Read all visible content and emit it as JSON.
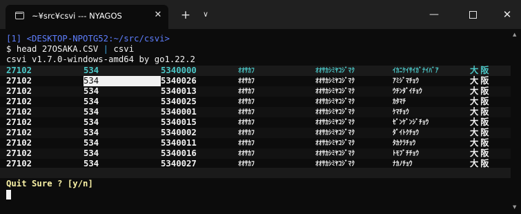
{
  "tab": {
    "title": "~¥src¥csvi --- NYAGOS",
    "icon": "terminal-icon",
    "close_glyph": "✕"
  },
  "tabbar": {
    "new_tab_glyph": "+",
    "dropdown_glyph": "∨"
  },
  "window_controls": {
    "minimize_glyph": "—",
    "close_glyph": "✕"
  },
  "terminal": {
    "prompt_line": "[1] <DESKTOP-NPOTG52:~/src/csvi>",
    "command_sigil": "$ ",
    "command_before_pipe": "head 27OSAKA.CSV ",
    "command_pipe": "|",
    "command_after_pipe": " csvi",
    "version_line": "csvi v1.7.0-windows-amd64 by go1.22.2",
    "header_row": [
      "27102",
      "534",
      "5340000",
      "ｵｵｻｶﾌ",
      "ｵｵｻｶｼﾐﾔｺｼﾞﾏｸ",
      "ｲｶﾆｹｲｻｲｶﾞﾅｲﾊﾞｱ",
      "大阪"
    ],
    "rows": [
      [
        "27102",
        "534",
        "5340026",
        "ｵｵｻｶﾌ",
        "ｵｵｻｶｼﾐﾔｺｼﾞﾏｸ",
        "ｱﾐｼﾞﾏﾁｮｳ",
        "大阪"
      ],
      [
        "27102",
        "534",
        "5340013",
        "ｵｵｻｶﾌ",
        "ｵｵｻｶｼﾐﾔｺｼﾞﾏｸ",
        "ｳﾁﾝﾀﾞｲﾁｮｳ",
        "大阪"
      ],
      [
        "27102",
        "534",
        "5340025",
        "ｵｵｻｶﾌ",
        "ｵｵｻｶｼﾐﾔｺｼﾞﾏｸ",
        "ｶﾀﾏﾁ",
        "大阪"
      ],
      [
        "27102",
        "534",
        "5340001",
        "ｵｵｻｶﾌ",
        "ｵｵｻｶｼﾐﾔｺｼﾞﾏｸ",
        "ｹﾏﾁｮｳ",
        "大阪"
      ],
      [
        "27102",
        "534",
        "5340015",
        "ｵｵｻｶﾌ",
        "ｵｵｻｶｼﾐﾔｺｼﾞﾏｸ",
        "ｾﾞﾝｹﾞﾝｼﾞﾁｮｳ",
        "大阪"
      ],
      [
        "27102",
        "534",
        "5340002",
        "ｵｵｻｶﾌ",
        "ｵｵｻｶｼﾐﾔｺｼﾞﾏｸ",
        "ﾀﾞｲﾄｸﾁｮｳ",
        "大阪"
      ],
      [
        "27102",
        "534",
        "5340011",
        "ｵｵｻｶﾌ",
        "ｵｵｻｶｼﾐﾔｺｼﾞﾏｸ",
        "ﾀｶｸﾗﾁｮｳ",
        "大阪"
      ],
      [
        "27102",
        "534",
        "5340016",
        "ｵｵｻｶﾌ",
        "ｵｵｻｶｼﾐﾔｺｼﾞﾏｸ",
        "ﾄﾓﾌﾞﾁﾁｮｳ",
        "大阪"
      ],
      [
        "27102",
        "534",
        "5340027",
        "ｵｵｻｶﾌ",
        "ｵｵｻｶｼﾐﾔｺｼﾞﾏｸ",
        "ﾅｶﾉﾁｮｳ",
        "大阪"
      ]
    ],
    "selected_cell": {
      "row": 0,
      "col": 1
    },
    "quit_prompt": "Quit Sure ? [y/n]"
  },
  "colors": {
    "background": "#0c0c0c",
    "titlebar": "#202020",
    "prompt_blue": "#5f7fff",
    "header_cyan": "#4cc7c7",
    "quit_yellow": "#f9f1a5",
    "text": "#f2f2f2"
  }
}
